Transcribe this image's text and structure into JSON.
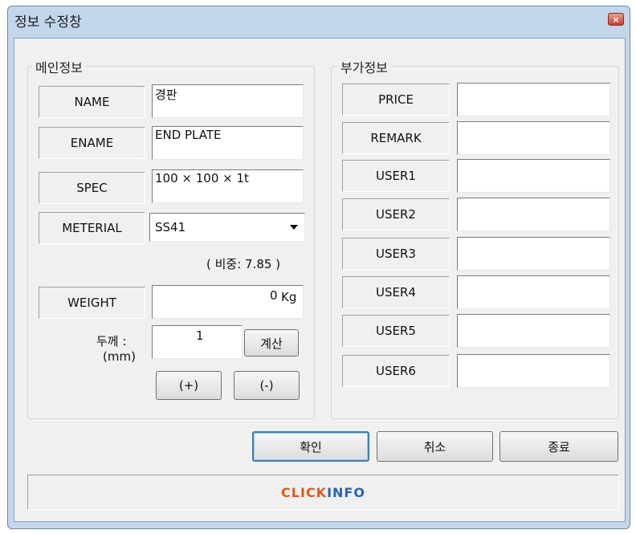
{
  "window": {
    "title": "정보 수정창",
    "close_glyph": "×"
  },
  "main_group": {
    "title": "메인정보",
    "name_label": "NAME",
    "name_value": "경판",
    "ename_label": "ENAME",
    "ename_value": "END PLATE",
    "spec_label": "SPEC",
    "spec_value": "100 × 100 × 1t",
    "material_label": "METERIAL",
    "material_value": "SS41",
    "density_text": "( 비중: 7.85 )",
    "weight_label": "WEIGHT",
    "weight_value": "0",
    "weight_unit": "Kg",
    "thickness_label": "두께 :",
    "thickness_unit": "(mm)",
    "thickness_value": "1",
    "calc_button": "계산",
    "plus_button": "(+)",
    "minus_button": "(-)"
  },
  "extra_group": {
    "title": "부가정보",
    "fields": [
      {
        "label": "PRICE",
        "value": ""
      },
      {
        "label": "REMARK",
        "value": ""
      },
      {
        "label": "USER1",
        "value": ""
      },
      {
        "label": "USER2",
        "value": ""
      },
      {
        "label": "USER3",
        "value": ""
      },
      {
        "label": "USER4",
        "value": ""
      },
      {
        "label": "USER5",
        "value": ""
      },
      {
        "label": "USER6",
        "value": ""
      }
    ]
  },
  "buttons": {
    "ok": "확인",
    "cancel": "취소",
    "exit": "종료"
  },
  "status": {
    "brand_part1": "CLICK",
    "brand_part2": "INFO"
  },
  "colors": {
    "brand_orange": "#e2581a",
    "brand_blue": "#2a62b8",
    "focus_border": "#3c7fb1"
  }
}
